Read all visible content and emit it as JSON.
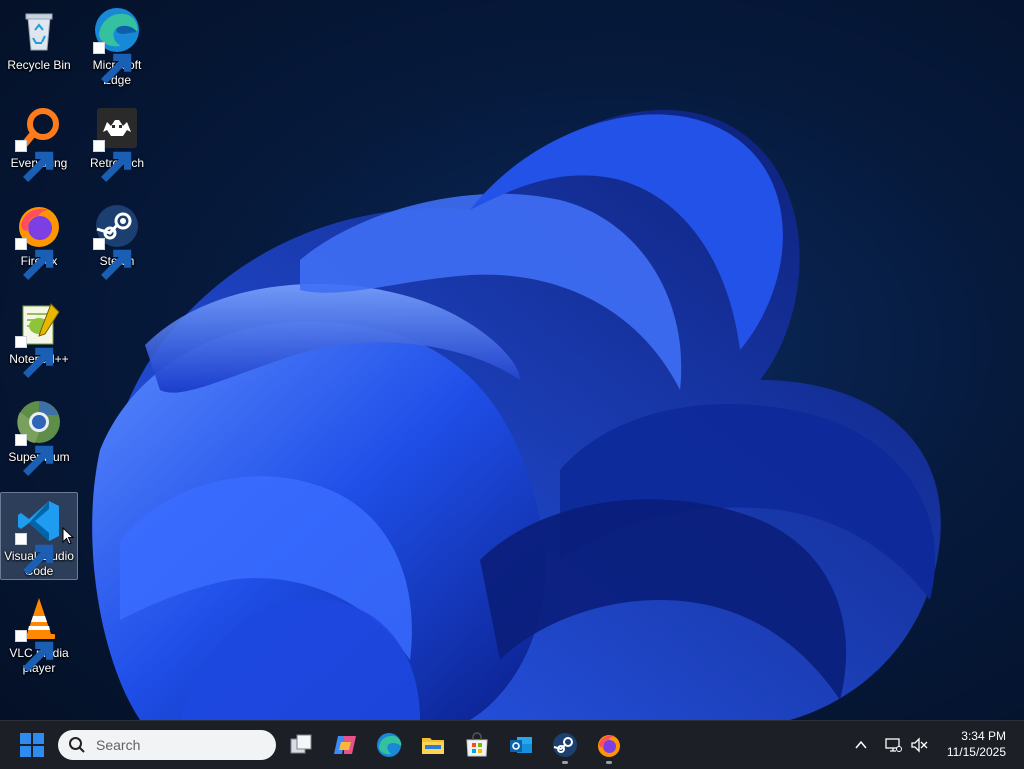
{
  "desktop": {
    "icons": [
      {
        "label": "Recycle Bin",
        "icon": "recycle-bin-icon",
        "shortcut": false
      },
      {
        "label": "Microsoft Edge",
        "icon": "edge-icon",
        "shortcut": true
      },
      {
        "label": "Everything",
        "icon": "everything-search-icon",
        "shortcut": true
      },
      {
        "label": "RetroArch",
        "icon": "retroarch-icon",
        "shortcut": true
      },
      {
        "label": "Firefox",
        "icon": "firefox-icon",
        "shortcut": true
      },
      {
        "label": "Steam",
        "icon": "steam-icon",
        "shortcut": true
      },
      {
        "label": "Notepad++",
        "icon": "notepad-plus-plus-icon",
        "shortcut": true
      },
      {
        "label": "Supermium",
        "icon": "supermium-icon",
        "shortcut": true
      },
      {
        "label": "Visual Studio Code",
        "icon": "vscode-icon",
        "shortcut": true,
        "selected": true
      },
      {
        "label": "VLC media player",
        "icon": "vlc-icon",
        "shortcut": true
      }
    ]
  },
  "taskbar": {
    "search": {
      "placeholder": "Search"
    },
    "pinned": [
      {
        "name": "task-view",
        "icon": "task-view-icon"
      },
      {
        "name": "copilot",
        "icon": "copilot-icon"
      },
      {
        "name": "microsoft-edge",
        "icon": "edge-icon"
      },
      {
        "name": "file-explorer",
        "icon": "folder-icon"
      },
      {
        "name": "microsoft-store",
        "icon": "store-icon"
      },
      {
        "name": "outlook",
        "icon": "outlook-icon"
      },
      {
        "name": "steam",
        "icon": "steam-icon",
        "running": true
      },
      {
        "name": "firefox",
        "icon": "firefox-icon",
        "running": true
      }
    ],
    "tray": {
      "chevron": "chevron-up-icon",
      "network": "network-icon",
      "volume": "volume-muted-icon"
    },
    "clock": {
      "time": "3:34 PM",
      "date": "11/15/2025"
    }
  },
  "colors": {
    "wallpaper_bloom": "#1a4fe0",
    "wallpaper_bg": "#061a3d",
    "taskbar_bg": "#1c1f26",
    "start_blue": "#2e8bf0"
  }
}
